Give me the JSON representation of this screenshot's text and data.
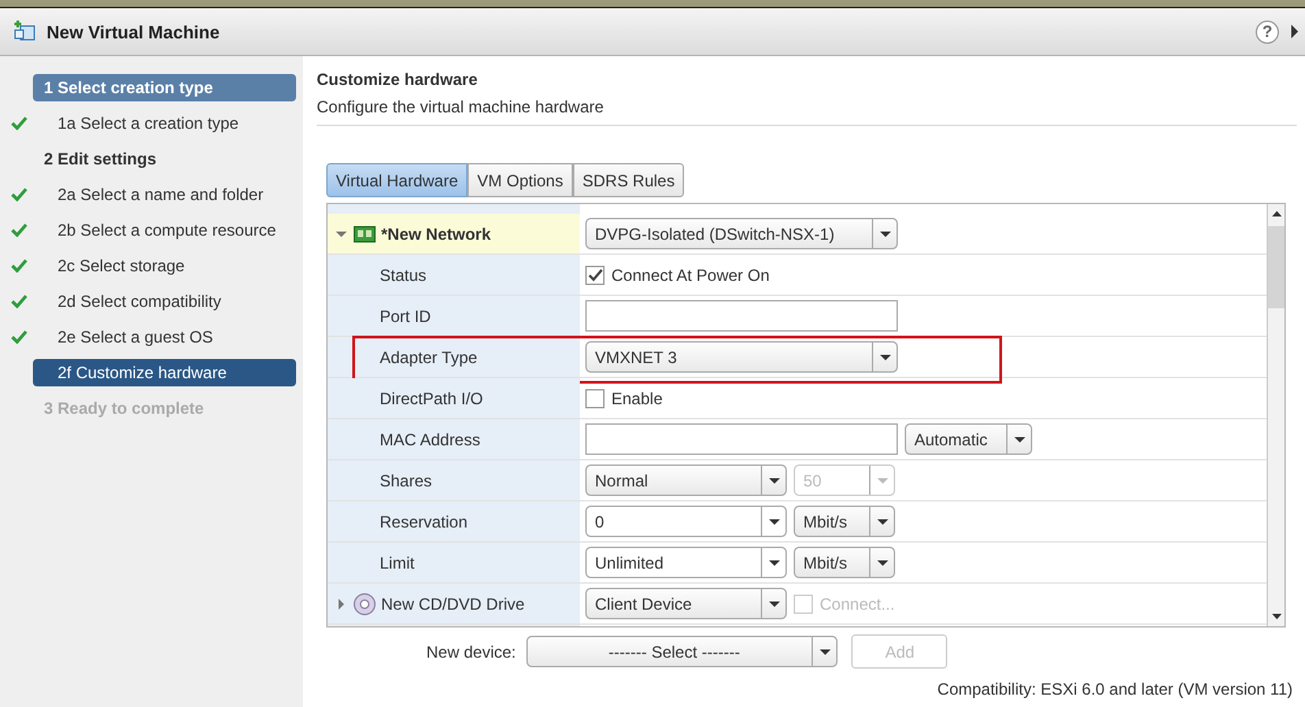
{
  "window": {
    "title": "New Virtual Machine",
    "help": "?"
  },
  "steps": [
    {
      "kind": "header",
      "label": "1  Select creation type",
      "selected": true,
      "done": false,
      "disabled": false
    },
    {
      "kind": "sub",
      "label": "1a  Select a creation type",
      "selected": false,
      "done": true,
      "disabled": false
    },
    {
      "kind": "header",
      "label": "2  Edit settings",
      "selected": false,
      "done": false,
      "disabled": false
    },
    {
      "kind": "sub",
      "label": "2a  Select a name and folder",
      "selected": false,
      "done": true,
      "disabled": false
    },
    {
      "kind": "sub",
      "label": "2b  Select a compute resource",
      "selected": false,
      "done": true,
      "disabled": false
    },
    {
      "kind": "sub",
      "label": "2c  Select storage",
      "selected": false,
      "done": true,
      "disabled": false
    },
    {
      "kind": "sub",
      "label": "2d  Select compatibility",
      "selected": false,
      "done": true,
      "disabled": false
    },
    {
      "kind": "sub",
      "label": "2e  Select a guest OS",
      "selected": false,
      "done": true,
      "disabled": false
    },
    {
      "kind": "sub",
      "label": "2f Customize hardware",
      "selected": true,
      "done": false,
      "disabled": false
    },
    {
      "kind": "header",
      "label": "3  Ready to complete",
      "selected": false,
      "done": false,
      "disabled": true
    }
  ],
  "page": {
    "title": "Customize hardware",
    "subtitle": "Configure the virtual machine hardware"
  },
  "tabs": [
    {
      "label": "Virtual Hardware",
      "selected": true
    },
    {
      "label": "VM Options",
      "selected": false
    },
    {
      "label": "SDRS Rules",
      "selected": false
    }
  ],
  "rows": [
    {
      "kind": "network",
      "label": "*New Network",
      "expanded": true,
      "controls": [
        {
          "kind": "dropdown",
          "value": "DVPG-Isolated (DSwitch-NSX-1)"
        }
      ]
    },
    {
      "kind": "property",
      "label": "Status",
      "controls": [
        {
          "kind": "checkbox",
          "value": "Connect At Power On",
          "checked": true
        }
      ]
    },
    {
      "kind": "property",
      "label": "Port ID",
      "controls": [
        {
          "kind": "input"
        }
      ]
    },
    {
      "kind": "property",
      "label": "Adapter Type",
      "annotated": true,
      "controls": [
        {
          "kind": "dropdown",
          "value": "VMXNET 3"
        }
      ]
    },
    {
      "kind": "property",
      "label": "DirectPath I/O",
      "controls": [
        {
          "kind": "checkbox",
          "value": "Enable",
          "checked": false
        }
      ]
    },
    {
      "kind": "property",
      "label": "MAC Address",
      "controls": [
        {
          "kind": "input"
        },
        {
          "kind": "dropdown",
          "value": "Automatic"
        }
      ]
    },
    {
      "kind": "property",
      "label": "Shares",
      "controls": [
        {
          "kind": "dropdown",
          "value": "Normal"
        },
        {
          "kind": "dropdown",
          "value": "50",
          "disabled": true
        }
      ]
    },
    {
      "kind": "property",
      "label": "Reservation",
      "controls": [
        {
          "kind": "combo",
          "value": "0"
        },
        {
          "kind": "dropdown",
          "value": "Mbit/s"
        }
      ]
    },
    {
      "kind": "property",
      "label": "Limit",
      "controls": [
        {
          "kind": "combo",
          "value": "Unlimited"
        },
        {
          "kind": "dropdown",
          "value": "Mbit/s"
        }
      ]
    },
    {
      "kind": "drive",
      "label": "New CD/DVD Drive",
      "expanded": false,
      "controls": [
        {
          "kind": "dropdown",
          "value": "Client Device"
        },
        {
          "kind": "checkbox",
          "value": "Connect...",
          "checked": false,
          "disabled": true
        }
      ]
    }
  ],
  "new_device": {
    "label": "New device:",
    "value": "------- Select -------",
    "button": "Add",
    "button_disabled": true
  },
  "footer": "Compatibility: ESXi 6.0 and later (VM version 11)"
}
